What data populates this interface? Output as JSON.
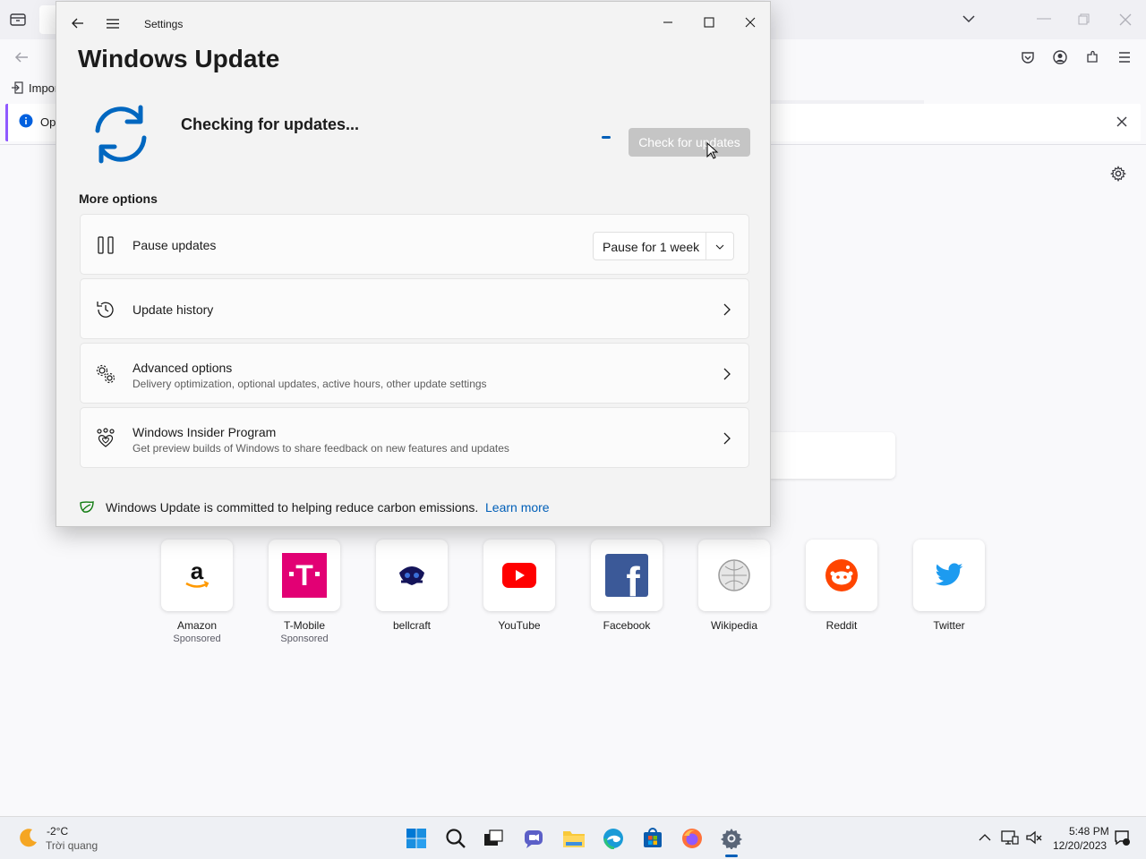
{
  "firefox": {
    "import_label": "Impor",
    "notice_label": "Op",
    "tiles": [
      {
        "name": "Amazon",
        "sub": "Sponsored",
        "icon": "amazon-icon"
      },
      {
        "name": "T-Mobile",
        "sub": "Sponsored",
        "icon": "tmobile-icon"
      },
      {
        "name": "bellcraft",
        "sub": "",
        "icon": "bellcraft-icon"
      },
      {
        "name": "YouTube",
        "sub": "",
        "icon": "youtube-icon"
      },
      {
        "name": "Facebook",
        "sub": "",
        "icon": "facebook-icon"
      },
      {
        "name": "Wikipedia",
        "sub": "",
        "icon": "wikipedia-icon"
      },
      {
        "name": "Reddit",
        "sub": "",
        "icon": "reddit-icon"
      },
      {
        "name": "Twitter",
        "sub": "",
        "icon": "twitter-icon"
      }
    ]
  },
  "settings": {
    "window_title": "Settings",
    "page_title": "Windows Update",
    "status": "Checking for updates...",
    "check_button": "Check for updates",
    "more_options": "More options",
    "pause": {
      "title": "Pause updates",
      "dropdown": "Pause for 1 week"
    },
    "history": {
      "title": "Update history"
    },
    "advanced": {
      "title": "Advanced options",
      "desc": "Delivery optimization, optional updates, active hours, other update settings"
    },
    "insider": {
      "title": "Windows Insider Program",
      "desc": "Get preview builds of Windows to share feedback on new features and updates"
    },
    "footer": {
      "text": "Windows Update is committed to helping reduce carbon emissions.",
      "link": "Learn more"
    }
  },
  "taskbar": {
    "weather_temp": "-2°C",
    "weather_desc": "Trời quang",
    "time": "5:48 PM",
    "date": "12/20/2023"
  },
  "colors": {
    "accent": "#005fb8",
    "firefox_purple": "#9059ff"
  }
}
